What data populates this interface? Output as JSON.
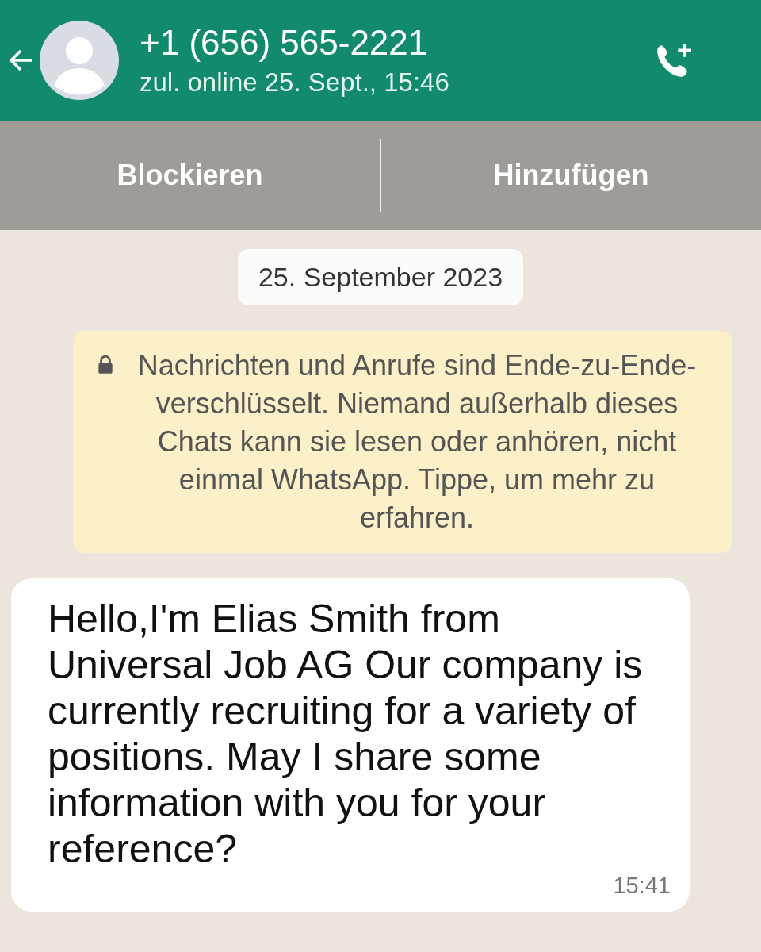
{
  "header": {
    "title": "+1 (656) 565-2221",
    "subtitle": "zul. online 25. Sept., 15:46"
  },
  "actions": [
    "Blockieren",
    "Hinzufügen"
  ],
  "date_chip": "25. September 2023",
  "encryption_notice": "Nachrichten und Anrufe sind Ende-zu-Ende-verschlüsselt. Niemand außerhalb dieses Chats kann sie lesen oder anhören, nicht einmal WhatsApp. Tippe, um mehr zu erfahren.",
  "messages": [
    {
      "text": "Hello,I'm Elias Smith from Universal Job AG Our company is currently recruiting for a variety of positions. May I share some information with you for your reference?",
      "time": "15:41"
    }
  ]
}
